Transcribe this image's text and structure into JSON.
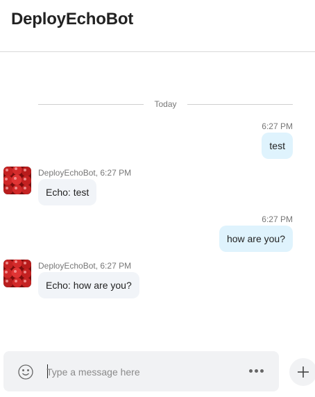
{
  "header": {
    "title": "DeployEchoBot"
  },
  "divider": {
    "label": "Today"
  },
  "messages": [
    {
      "direction": "outgoing",
      "time": "6:27 PM",
      "text": "test"
    },
    {
      "direction": "incoming",
      "meta": "DeployEchoBot, 6:27 PM",
      "text": "Echo: test"
    },
    {
      "direction": "outgoing",
      "time": "6:27 PM",
      "text": "how are you?"
    },
    {
      "direction": "incoming",
      "meta": "DeployEchoBot, 6:27 PM",
      "text": "Echo: how are you?"
    }
  ],
  "composer": {
    "placeholder": "Type a message here",
    "value": "",
    "emoji_icon": "emoji-icon",
    "more_icon": "more-options-icon",
    "add_icon": "plus-icon"
  },
  "colors": {
    "outgoing_bubble": "#dff3fd",
    "incoming_bubble": "#f1f4f8",
    "composer_bg": "#f1f2f4"
  }
}
